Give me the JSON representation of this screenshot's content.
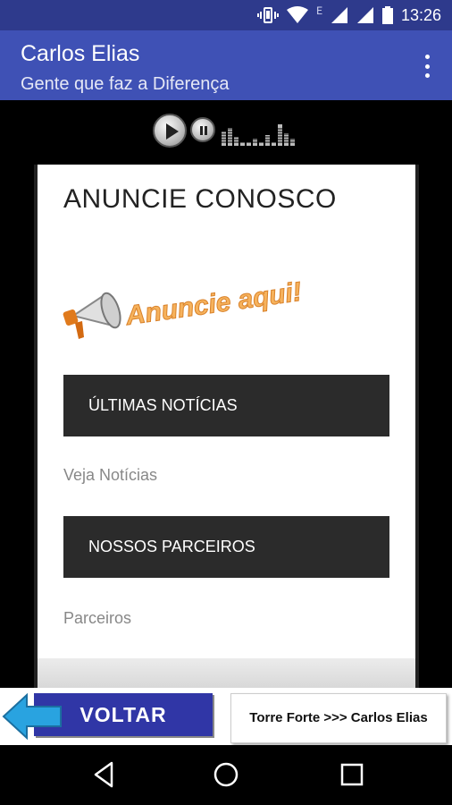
{
  "status_bar": {
    "time": "13:26",
    "network_label": "E",
    "icons": [
      "vibrate-icon",
      "wifi-icon",
      "signal-icon",
      "signal-icon",
      "battery-icon"
    ]
  },
  "app_bar": {
    "title": "Carlos Elias",
    "subtitle": "Gente que faz a Diferença",
    "menu_icon": "overflow-menu-icon"
  },
  "player": {
    "controls": [
      "play-icon",
      "pause-icon",
      "equalizer-icon"
    ]
  },
  "page": {
    "heading": "ANUNCIE CONOSCO",
    "ad_text": "Anuncie aqui!",
    "sections": [
      {
        "title": "ÚLTIMAS NOTÍCIAS",
        "link": "Veja Notícias"
      },
      {
        "title": "NOSSOS PARCEIROS",
        "link": "Parceiros"
      }
    ]
  },
  "bottom_banner": {
    "back_label": "VOLTAR",
    "site_label": "Torre Forte >>> Carlos Elias"
  },
  "nav_bar": {
    "buttons": [
      "back-icon",
      "home-icon",
      "recents-icon"
    ]
  },
  "colors": {
    "status_bar": "#2e3a8c",
    "app_bar": "#3f51b5",
    "section_box": "#2b2b2b",
    "voltar_button": "#3036a6",
    "back_arrow": "#29a3e0",
    "ad_text": "#f39a2b"
  }
}
